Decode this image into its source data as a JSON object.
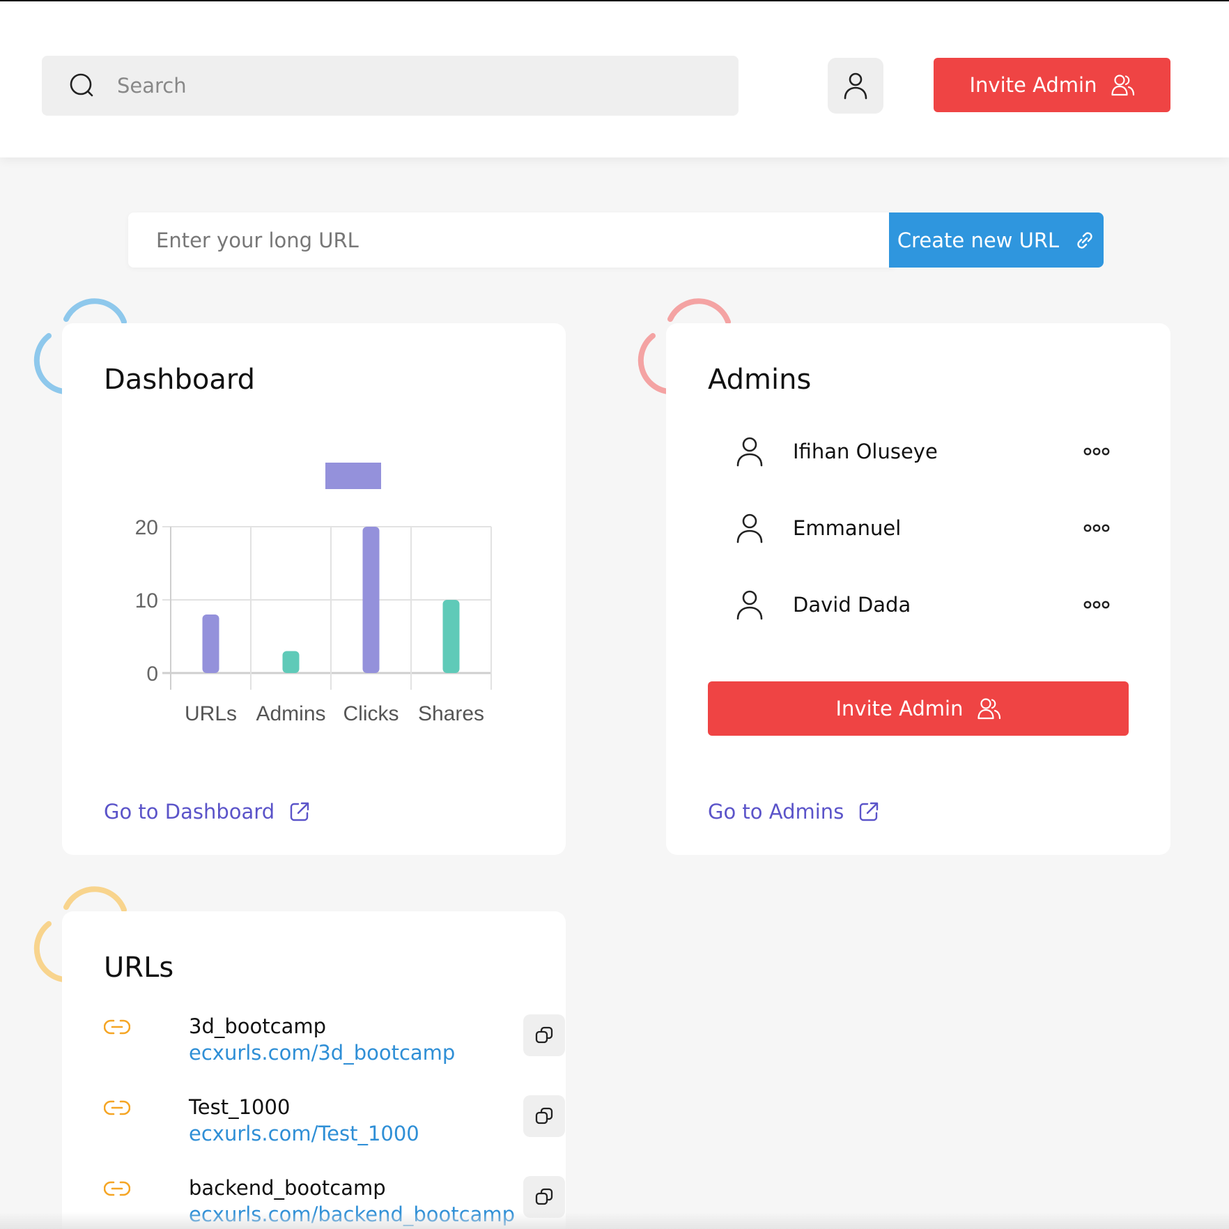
{
  "header": {
    "search_placeholder": "Search",
    "invite_label": "Invite Admin"
  },
  "url_form": {
    "placeholder": "Enter your long URL",
    "create_label": "Create new URL"
  },
  "dashboard": {
    "title": "Dashboard",
    "link_label": "Go to Dashboard"
  },
  "chart_data": {
    "type": "bar",
    "categories": [
      "URLs",
      "Admins",
      "Clicks",
      "Shares"
    ],
    "values": [
      8,
      3,
      20,
      10
    ],
    "bar_colors": [
      "#9491db",
      "#5fcab8",
      "#9491db",
      "#5fcab8"
    ],
    "y_ticks": [
      0,
      10,
      20
    ],
    "ylim": [
      0,
      20
    ],
    "grid": true,
    "legend_swatch_color": "#9491db"
  },
  "admins": {
    "title": "Admins",
    "items": [
      {
        "name": "Ifihan Oluseye"
      },
      {
        "name": "Emmanuel"
      },
      {
        "name": "David Dada"
      }
    ],
    "invite_label": "Invite Admin",
    "link_label": "Go to Admins"
  },
  "urls": {
    "title": "URLs",
    "items": [
      {
        "slug": "3d_bootcamp",
        "short": "ecxurls.com/3d_bootcamp"
      },
      {
        "slug": "Test_1000",
        "short": "ecxurls.com/Test_1000"
      },
      {
        "slug": "backend_bootcamp",
        "short": "ecxurls.com/backend_bootcamp"
      }
    ]
  },
  "colors": {
    "accent_red": "#ef4444",
    "accent_blue": "#2f96de",
    "link_purple": "#5b54c9",
    "deco_blue": "#8ec8ec",
    "deco_red": "#f4a3a3",
    "deco_orange": "#f8d48d"
  }
}
